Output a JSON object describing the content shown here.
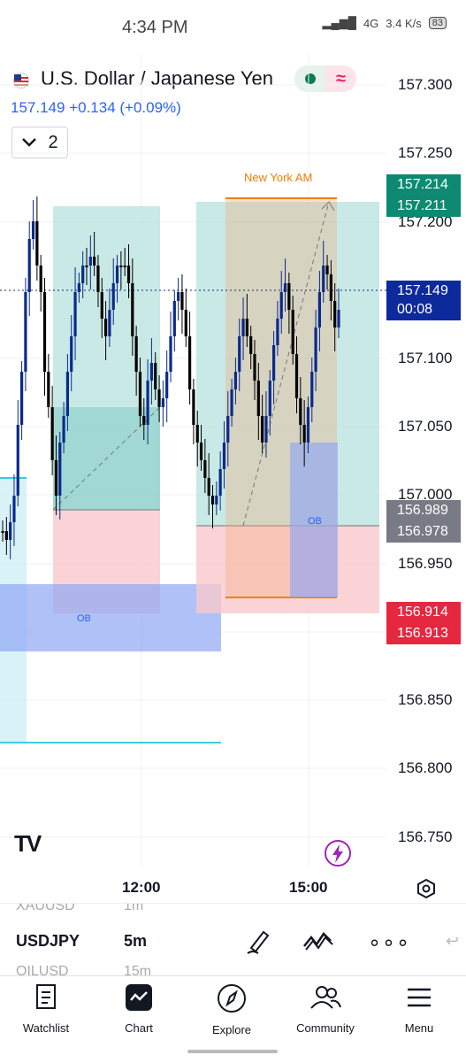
{
  "status_bar": {
    "time": "4:34 PM",
    "network": "4G",
    "speed": "3.4 K/s",
    "battery": "83"
  },
  "header": {
    "symbol_name": "U.S. Dollar / Japanese Yen",
    "last_price": "157.149",
    "change": "+0.134 (+0.09%)",
    "interval_count": "2"
  },
  "chart": {
    "session_label": "New York AM",
    "ob_labels": [
      "OB",
      "OB"
    ],
    "price_axis": [
      "157.300",
      "157.250",
      "157.200",
      "157.100",
      "157.050",
      "157.000",
      "156.950",
      "156.850",
      "156.800",
      "156.750"
    ],
    "tags": {
      "target_1": "157.214",
      "target_2": "157.211",
      "last": "157.149",
      "countdown": "00:08",
      "entry_1": "156.989",
      "entry_2": "156.978",
      "stop_1": "156.914",
      "stop_2": "156.913"
    },
    "time_axis": [
      "12:00",
      "15:00"
    ],
    "colors": {
      "up": "#0a2a8c",
      "down": "#000000",
      "profit_zone": "#b2dfdb",
      "loss_zone": "#f8c8cc",
      "ob_zone": "#8fa6f5",
      "accent": "#2962ff"
    }
  },
  "watchlist_strip": {
    "rows": [
      {
        "symbol": "XAUUSD",
        "interval": "1m"
      },
      {
        "symbol": "USDJPY",
        "interval": "5m"
      },
      {
        "symbol": "OILUSD",
        "interval": "15m"
      }
    ]
  },
  "nav": {
    "items": [
      "Watchlist",
      "Chart",
      "Explore",
      "Community",
      "Menu"
    ]
  }
}
